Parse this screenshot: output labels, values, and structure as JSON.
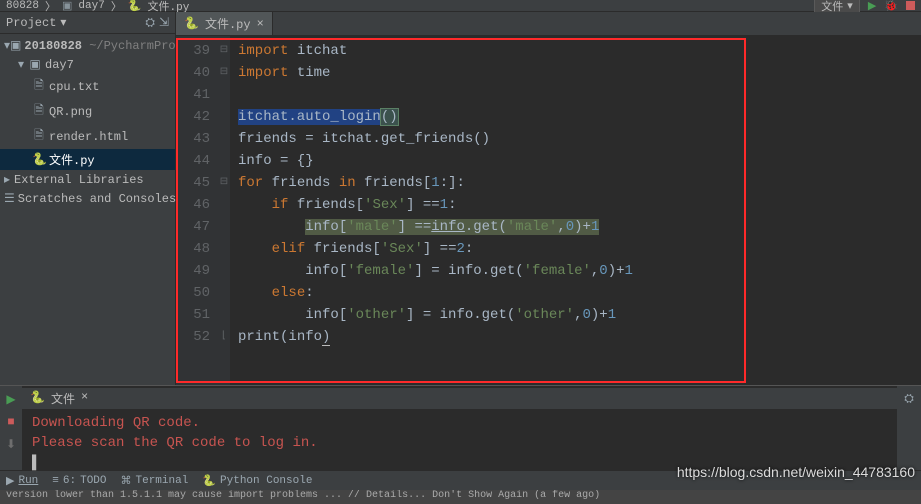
{
  "breadcrumb": {
    "a": "80828",
    "b": "day7",
    "c": "文件.py"
  },
  "toolbar": {
    "run_config": "文件"
  },
  "project": {
    "title": "Project",
    "root_name": "20180828",
    "root_path": "~/PycharmProjects",
    "folder": "day7",
    "files": {
      "cpu": "cpu.txt",
      "qr": "QR.png",
      "render": "render.html",
      "wenjian": "文件.py"
    },
    "ext_lib": "External Libraries",
    "scratches": "Scratches and Consoles"
  },
  "editor": {
    "tab_label": "文件.py",
    "line_start": 39,
    "lines": {
      "l39": {
        "a": "import",
        "b": " itchat"
      },
      "l40": {
        "a": "import",
        "b": " time"
      },
      "l41": "",
      "l42": {
        "a": "itchat.auto_login",
        "paren": "()"
      },
      "l43": {
        "a": "friends = itchat.get_friends()"
      },
      "l44": {
        "a": "info = {}"
      },
      "l45": {
        "a": "for",
        "b": " friends ",
        "c": "in",
        "d": " friends[",
        "e": "1",
        "f": ":]:"
      },
      "l46": {
        "a": "    ",
        "b": "if",
        "c": " friends[",
        "d": "'Sex'",
        "e": "] ==",
        "f": "1",
        "g": ":"
      },
      "l47": {
        "a": "        ",
        "b_sel": "info[",
        "c_sel": "'male'",
        "d_sel": "] ==",
        "e_sel_u": "info",
        "f_sel": ".get(",
        "g_sel": "'male'",
        "h_sel": ",",
        "i_sel": "0",
        "j_sel": ")+",
        "k_sel": "1"
      },
      "l48": {
        "a": "    ",
        "b": "elif",
        "c": " friends[",
        "d": "'Sex'",
        "e": "] ==",
        "f": "2",
        "g": ":"
      },
      "l49": {
        "a": "        info[",
        "b": "'female'",
        "c": "] = info.get(",
        "d": "'female'",
        "e": ",",
        "f": "0",
        "g": ")+",
        "h": "1"
      },
      "l50": {
        "a": "    ",
        "b": "else",
        "c": ":"
      },
      "l51": {
        "a": "        info[",
        "b": "'other'",
        "c": "] = info.get(",
        "d": "'other'",
        "e": ",",
        "f": "0",
        "g": ")+",
        "h": "1"
      },
      "l52": {
        "a": "print",
        "b": "(info",
        "c": ")"
      }
    }
  },
  "console": {
    "tab": "文件",
    "l1": "Downloading QR code.",
    "l2": "Please scan the QR code to log in."
  },
  "statusbar": {
    "run": "Run",
    "todo_n": "6:",
    "todo": "TODO",
    "terminal": "Terminal",
    "pyconsole": "Python Console"
  },
  "hint": "version lower than 1.5.1.1 may cause import problems ... // Details... Don't Show Again (a few ago)",
  "watermark": "https://blog.csdn.net/weixin_44783160"
}
